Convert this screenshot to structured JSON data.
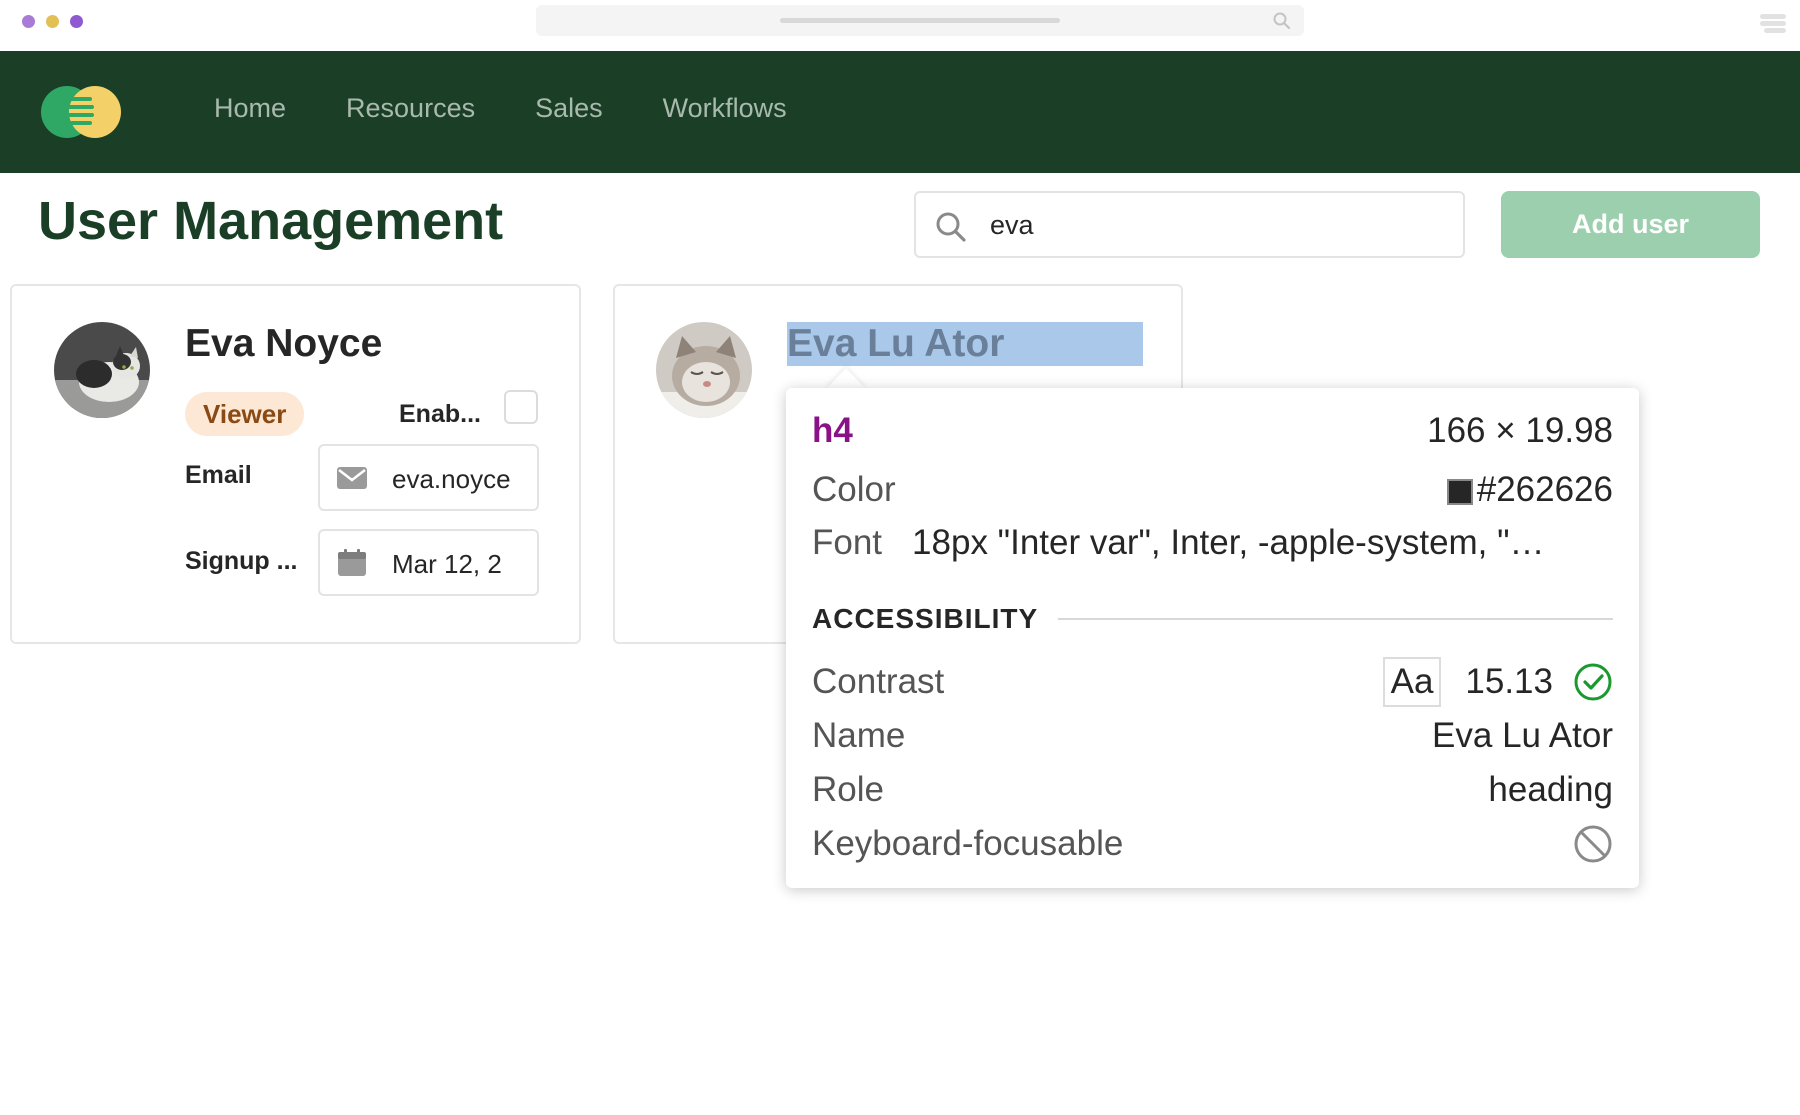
{
  "browser": {
    "dot_colors": [
      "#a77bd6",
      "#e2c053",
      "#8f5ad1"
    ]
  },
  "nav": {
    "items": [
      {
        "label": "Home"
      },
      {
        "label": "Resources"
      },
      {
        "label": "Sales"
      },
      {
        "label": "Workflows"
      }
    ],
    "background_color": "#1a3f26"
  },
  "header": {
    "title": "User Management",
    "search_value": "eva",
    "add_user_label": "Add user"
  },
  "users": [
    {
      "name": "Eva Noyce",
      "role_badge": "Viewer",
      "enabled_label": "Enab...",
      "email_label": "Email",
      "email_value": "eva.noyce",
      "signup_label": "Signup ...",
      "signup_value": "Mar 12, 2"
    },
    {
      "name": "Eva Lu Ator"
    }
  ],
  "inspector": {
    "tag": "h4",
    "dimensions": "166 × 19.98",
    "color_label": "Color",
    "color_value": "#262626",
    "font_label": "Font",
    "font_value": "18px \"Inter var\", Inter, -apple-system, \"…",
    "section_title": "ACCESSIBILITY",
    "contrast_label": "Contrast",
    "contrast_sample": "Aa",
    "contrast_value": "15.13",
    "name_label": "Name",
    "name_value": "Eva Lu Ator",
    "role_label": "Role",
    "role_value": "heading",
    "focusable_label": "Keyboard-focusable"
  }
}
